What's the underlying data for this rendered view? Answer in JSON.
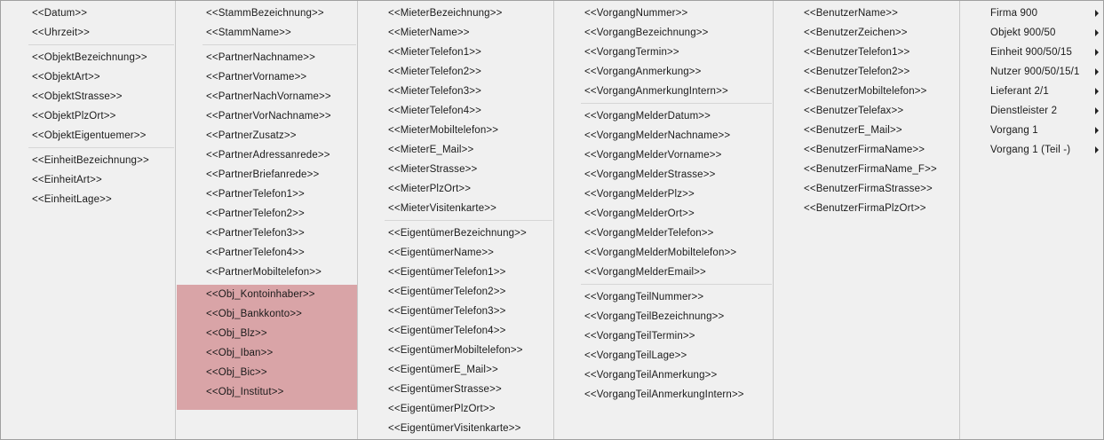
{
  "columns": [
    {
      "groups": [
        [
          "<<Datum>>",
          "<<Uhrzeit>>"
        ],
        [
          "<<ObjektBezeichnung>>",
          "<<ObjektArt>>",
          "<<ObjektStrasse>>",
          "<<ObjektPlzOrt>>",
          "<<ObjektEigentuemer>>"
        ],
        [
          "<<EinheitBezeichnung>>",
          "<<EinheitArt>>",
          "<<EinheitLage>>"
        ]
      ]
    },
    {
      "groups": [
        [
          "<<StammBezeichnung>>",
          "<<StammName>>"
        ],
        [
          "<<PartnerNachname>>",
          "<<PartnerVorname>>",
          "<<PartnerNachVorname>>",
          "<<PartnerVorNachname>>",
          "<<PartnerZusatz>>",
          "<<PartnerAdressanrede>>",
          "<<PartnerBriefanrede>>",
          "<<PartnerTelefon1>>",
          "<<PartnerTelefon2>>",
          "<<PartnerTelefon3>>",
          "<<PartnerTelefon4>>",
          "<<PartnerMobiltelefon>>"
        ]
      ],
      "highlighted": [
        "<<Obj_Kontoinhaber>>",
        "<<Obj_Bankkonto>>",
        "<<Obj_Blz>>",
        "<<Obj_Iban>>",
        "<<Obj_Bic>>",
        "<<Obj_Institut>>"
      ]
    },
    {
      "groups": [
        [
          "<<MieterBezeichnung>>",
          "<<MieterName>>",
          "<<MieterTelefon1>>",
          "<<MieterTelefon2>>",
          "<<MieterTelefon3>>",
          "<<MieterTelefon4>>",
          "<<MieterMobiltelefon>>",
          "<<MieterE_Mail>>",
          "<<MieterStrasse>>",
          "<<MieterPlzOrt>>",
          "<<MieterVisitenkarte>>"
        ],
        [
          "<<EigentümerBezeichnung>>",
          "<<EigentümerName>>",
          "<<EigentümerTelefon1>>",
          "<<EigentümerTelefon2>>",
          "<<EigentümerTelefon3>>",
          "<<EigentümerTelefon4>>",
          "<<EigentümerMobiltelefon>>",
          "<<EigentümerE_Mail>>",
          "<<EigentümerStrasse>>",
          "<<EigentümerPlzOrt>>",
          "<<EigentümerVisitenkarte>>"
        ]
      ]
    },
    {
      "groups": [
        [
          "<<VorgangNummer>>",
          "<<VorgangBezeichnung>>",
          "<<VorgangTermin>>",
          "<<VorgangAnmerkung>>",
          "<<VorgangAnmerkungIntern>>"
        ],
        [
          "<<VorgangMelderDatum>>",
          "<<VorgangMelderNachname>>",
          "<<VorgangMelderVorname>>",
          "<<VorgangMelderStrasse>>",
          "<<VorgangMelderPlz>>",
          "<<VorgangMelderOrt>>",
          "<<VorgangMelderTelefon>>",
          "<<VorgangMelderMobiltelefon>>",
          "<<VorgangMelderEmail>>"
        ],
        [
          "<<VorgangTeilNummer>>",
          "<<VorgangTeilBezeichnung>>",
          "<<VorgangTeilTermin>>",
          "<<VorgangTeilLage>>",
          "<<VorgangTeilAnmerkung>>",
          "<<VorgangTeilAnmerkungIntern>>"
        ]
      ]
    },
    {
      "groups": [
        [
          "<<BenutzerName>>",
          "<<BenutzerZeichen>>",
          "<<BenutzerTelefon1>>",
          "<<BenutzerTelefon2>>",
          "<<BenutzerMobiltelefon>>",
          "<<BenutzerTelefax>>",
          "<<BenutzerE_Mail>>",
          "<<BenutzerFirmaName>>",
          "<<BenutzerFirmaName_F>>",
          "<<BenutzerFirmaStrasse>>",
          "<<BenutzerFirmaPlzOrt>>"
        ]
      ]
    }
  ],
  "submenus": [
    "Firma 900",
    "Objekt 900/50",
    "Einheit 900/50/15",
    "Nutzer 900/50/15/1",
    "Lieferant 2/1",
    "Dienstleister 2",
    "Vorgang 1",
    "Vorgang 1 (Teil -)"
  ],
  "colors": {
    "highlight": "#d9a4a7",
    "background": "#f0f0f0",
    "separator": "#c8c8c8"
  }
}
